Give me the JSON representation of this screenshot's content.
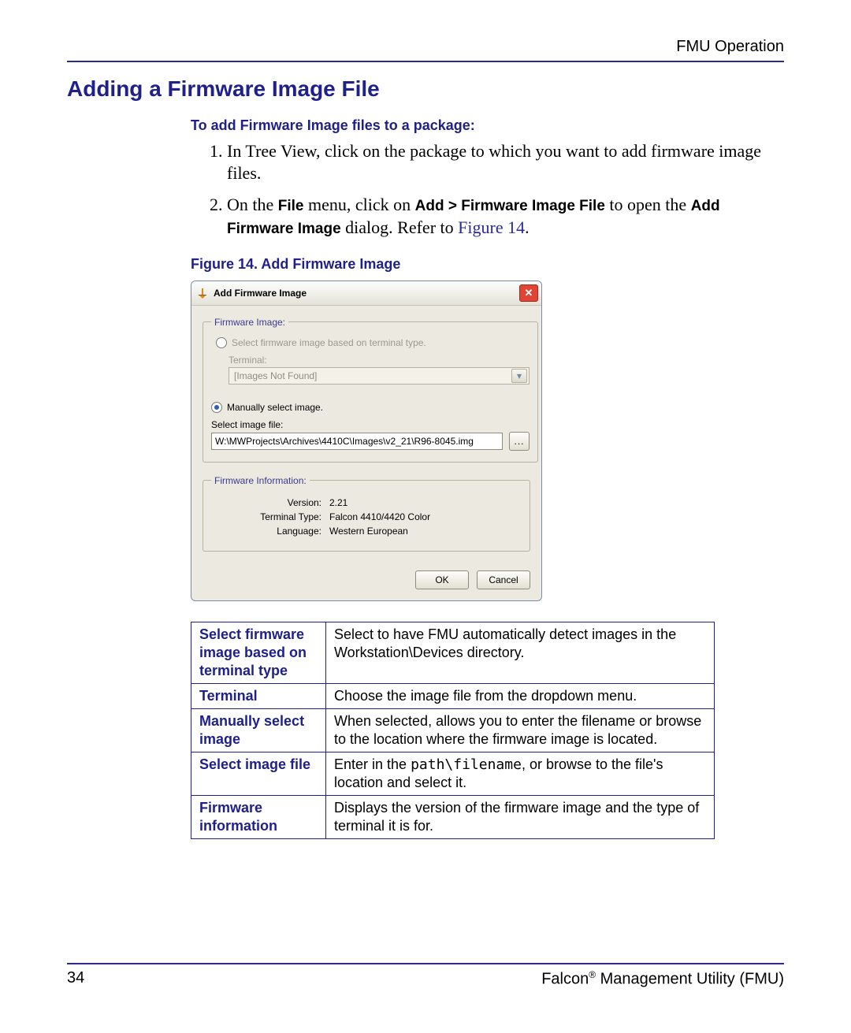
{
  "header": {
    "running": "FMU Operation"
  },
  "title": "Adding a Firmware Image File",
  "lead": "To add Firmware Image files to a package:",
  "steps": {
    "s1": "In Tree View, click on the package to which you want to add firmware image files.",
    "s2_pre": "On the ",
    "s2_file": "File",
    "s2_mid1": " menu, click on ",
    "s2_add": "Add > Firmware Image File",
    "s2_mid2": " to open the ",
    "s2_addfw": "Add Firmware Image",
    "s2_mid3": " dialog. Refer to ",
    "s2_ref": "Figure 14",
    "s2_end": "."
  },
  "fig_caption": "Figure 14. Add Firmware Image",
  "dialog": {
    "title": "Add Firmware Image",
    "close_glyph": "✕",
    "group1": {
      "legend": "Firmware Image:",
      "radio1_label": "Select firmware image based on terminal type.",
      "terminal_label": "Terminal:",
      "terminal_placeholder": "[Images Not Found]",
      "combo_chevron": "▾",
      "radio2_label": "Manually select image.",
      "select_file_label": "Select image file:",
      "path_value": "W:\\MWProjects\\Archives\\4410C\\Images\\v2_21\\R96-8045.img",
      "browse_label": "..."
    },
    "group2": {
      "legend": "Firmware Information:",
      "version_k": "Version:",
      "version_v": "2.21",
      "type_k": "Terminal Type:",
      "type_v": "Falcon 4410/4420 Color",
      "lang_k": "Language:",
      "lang_v": "Western European"
    },
    "ok": "OK",
    "cancel": "Cancel"
  },
  "table": {
    "r1k": "Select firmware image based on terminal type",
    "r1v": "Select to have FMU automatically detect images in the Workstation\\Devices directory.",
    "r2k": "Terminal",
    "r2v": "Choose the image file from the dropdown menu.",
    "r3k": "Manually select image",
    "r3v": "When selected, allows you to enter the filename or browse to the location where the firmware image is located.",
    "r4k": "Select image file",
    "r4v_pre": "Enter in the ",
    "r4v_code": "path\\filename",
    "r4v_post": ", or browse to the file's location and select it.",
    "r5k": "Firmware information",
    "r5v": "Displays the version of the firmware image and the type of terminal it is for."
  },
  "footer": {
    "page": "34",
    "product_pre": "Falcon",
    "product_reg": "®",
    "product_post": " Management Utility (FMU)"
  }
}
